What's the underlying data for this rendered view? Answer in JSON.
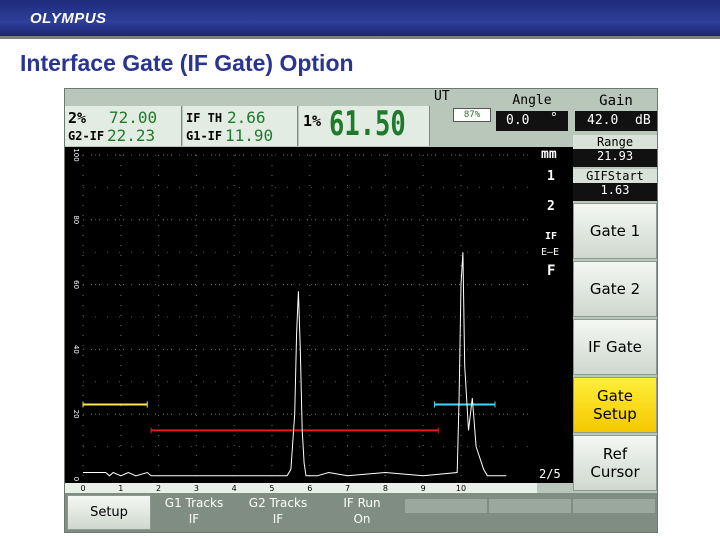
{
  "header": {
    "logo": "OLYMPUS",
    "title": "Interface Gate (IF Gate) Option"
  },
  "readings": {
    "g2_pct_label": "2%",
    "g2_pct_value": "72.00",
    "g2_if_label": "G2-IF",
    "g2_if_value": "22.23",
    "if_th_label": "IF TH",
    "if_th_value": "2.66",
    "g1_if_label": "G1-IF",
    "g1_if_value": "11.90",
    "one_pct_label": "1%",
    "big_value": "61.50"
  },
  "mode": {
    "label": "UT",
    "battery": "87%"
  },
  "controls": {
    "angle_label": "Angle",
    "angle_value": "0.0",
    "angle_symbol": "°",
    "gain_label": "Gain",
    "gain_value": "42.0",
    "gain_unit": "dB",
    "range_label": "Range",
    "range_value": "21.93",
    "gifstart_label": "GIFStart",
    "gifstart_value": "1.63"
  },
  "units": "mm",
  "gate_indicators": [
    "1",
    "2",
    "IF",
    "E—E",
    "F"
  ],
  "softkeys": [
    {
      "label": "Gate 1",
      "active": false
    },
    {
      "label": "Gate 2",
      "active": false
    },
    {
      "label": "IF Gate",
      "active": false
    },
    {
      "label": "Gate Setup",
      "active": true
    },
    {
      "label": "Ref Cursor",
      "active": false
    }
  ],
  "page_indicator": "2/5",
  "bottom_menu": [
    {
      "label": "Setup",
      "value": ""
    },
    {
      "label": "G1 Tracks",
      "value": "IF"
    },
    {
      "label": "G2 Tracks",
      "value": "IF"
    },
    {
      "label": "IF Run",
      "value": "On"
    },
    {
      "label": "",
      "value": ""
    },
    {
      "label": "",
      "value": ""
    },
    {
      "label": "",
      "value": ""
    }
  ],
  "chart_data": {
    "type": "line",
    "x_ticks": [
      "0",
      "1",
      "2",
      "3",
      "4",
      "5",
      "6",
      "7",
      "8",
      "9",
      "10"
    ],
    "y_ticks": [
      "0",
      "20",
      "40",
      "60",
      "80",
      "100"
    ],
    "xlim": [
      0,
      11.8
    ],
    "ylim": [
      0,
      100
    ],
    "grid": true,
    "gates": [
      {
        "name": "G1",
        "color": "#ffe84a",
        "start": 0.0,
        "end": 1.7,
        "level": 23
      },
      {
        "name": "IF",
        "color": "#e31b1b",
        "start": 1.8,
        "end": 9.4,
        "level": 15
      },
      {
        "name": "G2",
        "color": "#3fd7ff",
        "start": 9.3,
        "end": 10.9,
        "level": 23
      }
    ],
    "series": [
      {
        "points": [
          [
            0,
            2
          ],
          [
            0.6,
            2
          ],
          [
            0.7,
            1
          ],
          [
            0.8,
            2
          ],
          [
            1.0,
            1
          ],
          [
            1.2,
            2
          ],
          [
            1.4,
            1
          ],
          [
            1.7,
            2
          ],
          [
            1.8,
            1
          ],
          [
            5.4,
            1
          ],
          [
            5.5,
            3
          ],
          [
            5.6,
            20
          ],
          [
            5.65,
            45
          ],
          [
            5.7,
            58
          ],
          [
            5.75,
            40
          ],
          [
            5.8,
            15
          ],
          [
            5.85,
            5
          ],
          [
            5.9,
            1
          ],
          [
            6.2,
            1
          ],
          [
            6.5,
            2
          ],
          [
            7.0,
            1
          ],
          [
            8.0,
            2
          ],
          [
            9.0,
            1
          ],
          [
            9.9,
            2
          ],
          [
            9.95,
            25
          ],
          [
            10.0,
            60
          ],
          [
            10.05,
            70
          ],
          [
            10.1,
            35
          ],
          [
            10.2,
            15
          ],
          [
            10.3,
            25
          ],
          [
            10.4,
            10
          ],
          [
            10.6,
            3
          ],
          [
            10.7,
            1
          ],
          [
            11.2,
            1
          ]
        ]
      }
    ]
  }
}
